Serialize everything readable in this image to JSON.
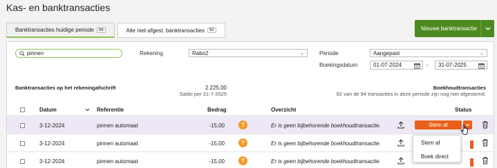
{
  "page": {
    "title": "Kas- en banktransacties"
  },
  "tabs": [
    {
      "label": "Banktransacties huidige periode",
      "count": "94"
    },
    {
      "label": "Alle niet-afgest. banktransacties",
      "count": "92"
    }
  ],
  "new_button": {
    "label": "Nieuwe banktransactie"
  },
  "filters": {
    "search_value": "pinnen",
    "rekening_label": "Rekening",
    "rekening_value": "Rabo2",
    "periode_label": "Periode",
    "periode_value": "Aangepast",
    "boekingsdatum_label": "Boekingsdatum",
    "date_from": "01-07-2024",
    "date_separator": "-",
    "date_to": "31-07-2025"
  },
  "summary": {
    "left_title": "Banktransacties op het rekeningafschrift",
    "amount": "2.225,00",
    "saldo": "Saldo per 31-7-2025",
    "right_title": "Boekhoudtransacties",
    "right_note": "92 van de 94 transacties in deze periode zijn nog niet afgestemd."
  },
  "table": {
    "headers": {
      "datum": "Datum",
      "referentie": "Referentie",
      "bedrag": "Bedrag",
      "overzicht": "Overzicht",
      "status": "Status"
    },
    "rows": [
      {
        "date": "3-12-2024",
        "reference": "pinnen automaat",
        "amount": "-15,00",
        "overview": "Er is geen bijbehorende boekhoudtransactie.",
        "status_button": "Stem af"
      },
      {
        "date": "3-12-2024",
        "reference": "pinnen automaat",
        "amount": "-15,00",
        "overview": "Er is geen bijbehorende boekhoudtransactie.",
        "status_button": ""
      },
      {
        "date": "3-12-2024",
        "reference": "pinnen automaat",
        "amount": "-15,00",
        "overview": "Er is geen bijbehorende boekhoudtransactie.",
        "status_button": ""
      }
    ]
  },
  "dropdown": {
    "items": [
      "Stem af",
      "Boek direct"
    ]
  },
  "colors": {
    "brand_green": "#4d8a1f",
    "accent_orange": "#e86019",
    "warning_orange": "#f39a27",
    "highlight_row": "#eee8f6"
  },
  "icons": [
    "search-icon",
    "chevron-down-icon",
    "calendar-icon",
    "sort-chevron-icon",
    "question-icon",
    "upload-icon",
    "trash-icon",
    "cursor-hand-icon"
  ]
}
